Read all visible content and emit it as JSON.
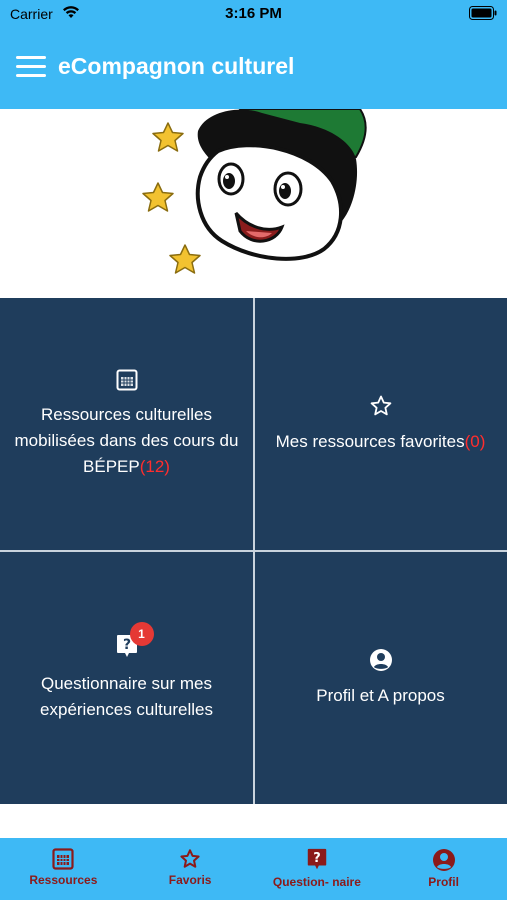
{
  "status_bar": {
    "carrier": "Carrier",
    "time": "3:16 PM"
  },
  "header": {
    "title": "eCompagnon culturel",
    "menu_icon": "hamburger-menu-icon"
  },
  "banner": {
    "image": "mascot-cartoon-boy-with-stars"
  },
  "tiles": [
    {
      "label": "Ressources culturelles mobilisées dans des cours du BÉPEP",
      "count": "(12)",
      "icon": "resources-grid-icon"
    },
    {
      "label": "Mes ressources favorites",
      "count": "(0)",
      "icon": "star-icon"
    },
    {
      "label": "Questionnaire sur mes expériences culturelles",
      "badge": "1",
      "icon": "question-bubble-icon"
    },
    {
      "label": "Profil et A propos",
      "icon": "user-circle-icon"
    }
  ],
  "bottom_nav": [
    {
      "label": "Ressources",
      "icon": "resources-grid-icon"
    },
    {
      "label": "Favoris",
      "icon": "star-icon"
    },
    {
      "label": "Question- naire",
      "icon": "question-bubble-icon"
    },
    {
      "label": "Profil",
      "icon": "user-circle-icon"
    }
  ],
  "colors": {
    "header": "#3eb9f5",
    "tiles": "#1f3d5c",
    "count": "#ff2d2d",
    "nav_label": "#8b1a1a"
  }
}
